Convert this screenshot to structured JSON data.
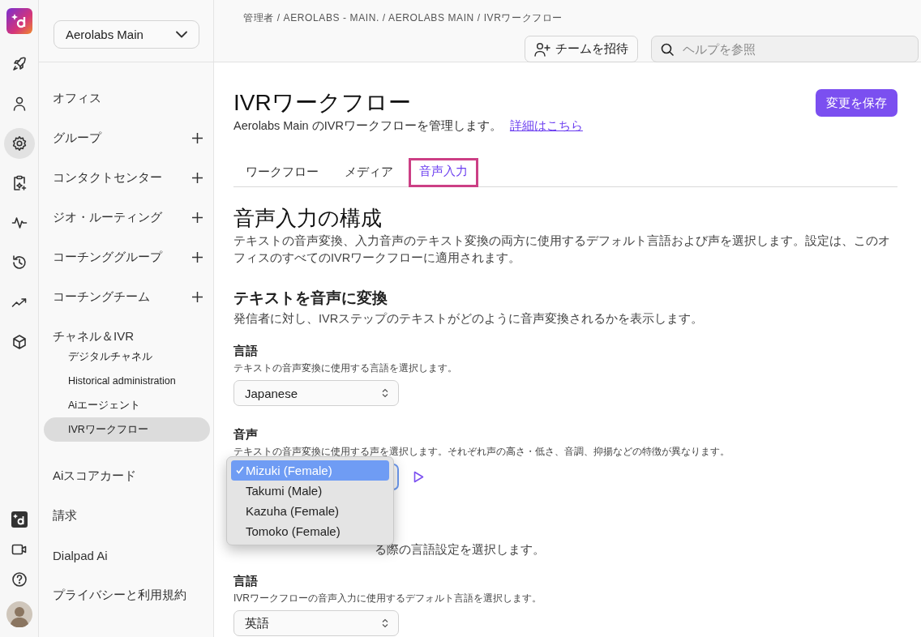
{
  "rail": {
    "nav": [
      {
        "kind": "rocket",
        "selected": false
      },
      {
        "kind": "person",
        "selected": false
      },
      {
        "kind": "gear",
        "selected": true
      },
      {
        "kind": "clipboard",
        "selected": false
      },
      {
        "kind": "pulse",
        "selected": false
      },
      {
        "kind": "history",
        "selected": false
      },
      {
        "kind": "trend",
        "selected": false
      },
      {
        "kind": "cube",
        "selected": false
      }
    ],
    "bottom": [
      {
        "kind": "brand"
      },
      {
        "kind": "video"
      },
      {
        "kind": "help"
      },
      {
        "kind": "avatar"
      }
    ]
  },
  "sidebar": {
    "office_select": {
      "value": "Aerolabs Main"
    },
    "items": [
      {
        "label": "オフィス",
        "expandable": false
      },
      {
        "label": "グループ",
        "expandable": true
      },
      {
        "label": "コンタクトセンター",
        "expandable": true
      },
      {
        "label": "ジオ・ルーティング",
        "expandable": true
      },
      {
        "label": "コーチンググループ",
        "expandable": true
      },
      {
        "label": "コーチングチーム",
        "expandable": true
      },
      {
        "label": "チャネル＆IVR",
        "expandable": false,
        "children": [
          {
            "label": "デジタルチャネル",
            "selected": false
          },
          {
            "label": "Historical administration",
            "selected": false
          },
          {
            "label": "Aiエージェント",
            "selected": false
          },
          {
            "label": "IVRワークフロー",
            "selected": true
          }
        ]
      },
      {
        "label": "Aiスコアカード",
        "expandable": false
      },
      {
        "label": "請求",
        "expandable": false
      },
      {
        "label": "Dialpad Ai",
        "expandable": false
      },
      {
        "label": "プライバシーと利用規約",
        "expandable": false
      }
    ]
  },
  "header": {
    "breadcrumb": "管理者 / AEROLABS - MAIN. / AEROLABS MAIN / IVRワークフロー",
    "invite_button": "チームを招待",
    "search": {
      "placeholder": "ヘルプを参照"
    }
  },
  "page": {
    "title": "IVRワークフロー",
    "subtitle": "Aerolabs Main のIVRワークフローを管理します。",
    "link": "詳細はこちら",
    "save_button": "変更を保存",
    "tabs": [
      {
        "label": "ワークフロー",
        "selected": false
      },
      {
        "label": "メディア",
        "selected": false
      },
      {
        "label": "音声入力",
        "selected": true
      }
    ],
    "section_title": "音声入力の構成",
    "section_description": "テキストの音声変換、入力音声のテキスト変換の両方に使用するデフォルト言語および声を選択します。設定は、このオフィスのすべてのIVRワークフローに適用されます。",
    "tts": {
      "heading": "テキストを音声に変換",
      "description": "発信者に対し、IVRステップのテキストがどのように音声変換されるかを表示します。",
      "language": {
        "label": "言語",
        "hint": "テキストの音声変換に使用する言語を選択します。",
        "value": "Japanese"
      },
      "voice": {
        "label": "音声",
        "hint": "テキストの音声変換に使用する声を選択します。それぞれ声の高さ・低さ、音調、抑揚などの特徴が異なります。",
        "options": [
          {
            "label": "Mizuki (Female)",
            "selected": true
          },
          {
            "label": "Takumi (Male)",
            "selected": false
          },
          {
            "label": "Kazuha (Female)",
            "selected": false
          },
          {
            "label": "Tomoko (Female)",
            "selected": false
          }
        ]
      }
    },
    "stt": {
      "description": "る際の言語設定を選択します。",
      "language": {
        "label": "言語",
        "hint": "IVRワークフローの音声入力に使用するデフォルト言語を選択します。",
        "value": "英語"
      }
    }
  }
}
